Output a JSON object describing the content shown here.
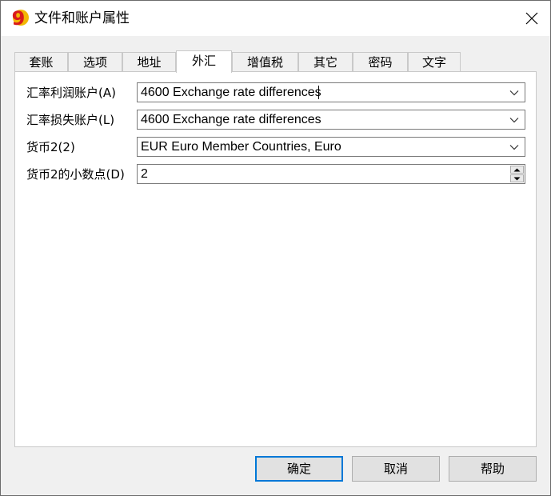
{
  "window": {
    "title": "文件和账户属性",
    "app_icon_glyph": "9",
    "close_glyph": "✕"
  },
  "tabs": [
    {
      "label": "套账",
      "active": false
    },
    {
      "label": "选项",
      "active": false
    },
    {
      "label": "地址",
      "active": false
    },
    {
      "label": "外汇",
      "active": true
    },
    {
      "label": "增值税",
      "active": false
    },
    {
      "label": "其它",
      "active": false
    },
    {
      "label": "密码",
      "active": false
    },
    {
      "label": "文字",
      "active": false
    }
  ],
  "fields": {
    "exchange_gain": {
      "label": "汇率利润账户(A)",
      "value": "4600 Exchange rate differences"
    },
    "exchange_loss": {
      "label": "汇率损失账户(L)",
      "value": "4600 Exchange rate differences"
    },
    "currency2": {
      "label": "货币2(2)",
      "value": "EUR Euro Member Countries, Euro"
    },
    "currency2_decimals": {
      "label": "货币2的小数点(D)",
      "value": "2"
    }
  },
  "buttons": {
    "ok": "确定",
    "cancel": "取消",
    "help": "帮助"
  },
  "colors": {
    "accent": "#0078d7",
    "app_icon_red": "#d91b1b",
    "app_icon_yellow": "#f2b705"
  },
  "icons": {
    "app": "banana-app-icon",
    "close": "close-icon",
    "dropdown": "chevron-down-icon",
    "spin_up": "triangle-up-icon",
    "spin_down": "triangle-down-icon"
  }
}
